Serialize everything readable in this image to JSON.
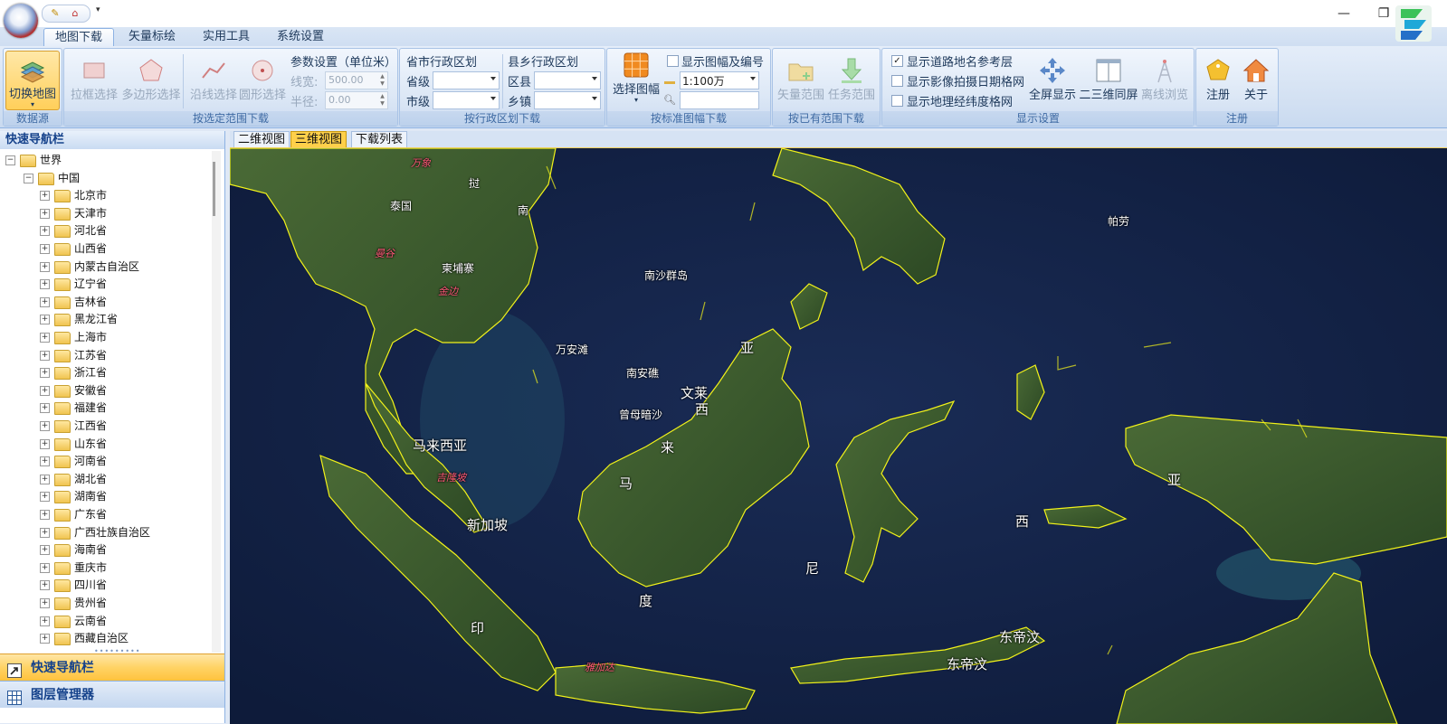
{
  "titlebar": {
    "minimize": "—",
    "maximize": "❐",
    "qat_dropdown": "▾"
  },
  "ribbon_tabs": [
    "地图下载",
    "矢量标绘",
    "实用工具",
    "系统设置"
  ],
  "groups": {
    "datasource": {
      "button": "切换地图",
      "caption": "数据源"
    },
    "range": {
      "buttons": [
        "拉框选择",
        "多边形选择",
        "沿线选择",
        "圆形选择"
      ],
      "params_title": "参数设置（单位米）",
      "line_width_label": "线宽:",
      "line_width_value": "500.00",
      "radius_label": "半径:",
      "radius_value": "0.00",
      "caption": "按选定范围下载"
    },
    "admin": {
      "province_city_title": "省市行政区划",
      "province_label": "省级",
      "city_label": "市级",
      "county_town_title": "县乡行政区划",
      "county_label": "区县",
      "town_label": "乡镇",
      "caption": "按行政区划下载"
    },
    "sheet": {
      "button": "选择图幅",
      "show_sheet_label": "显示图幅及编号",
      "scale_value": "1:100万",
      "caption": "按标准图幅下载"
    },
    "existing": {
      "buttons": [
        "矢量范围",
        "任务范围"
      ],
      "caption": "按已有范围下载"
    },
    "display": {
      "checks": [
        {
          "label": "显示道路地名参考层",
          "checked": true
        },
        {
          "label": "显示影像拍摄日期格网",
          "checked": false
        },
        {
          "label": "显示地理经纬度格网",
          "checked": false
        }
      ],
      "buttons": [
        "全屏显示",
        "二三维同屏",
        "离线浏览"
      ],
      "caption": "显示设置"
    },
    "register": {
      "buttons": [
        "注册",
        "关于"
      ],
      "caption": "注册"
    }
  },
  "left_panel": {
    "title": "快速导航栏",
    "tree_root": "世界",
    "tree_country": "中国",
    "tree_items": [
      "北京市",
      "天津市",
      "河北省",
      "山西省",
      "内蒙古自治区",
      "辽宁省",
      "吉林省",
      "黑龙江省",
      "上海市",
      "江苏省",
      "浙江省",
      "安徽省",
      "福建省",
      "江西省",
      "山东省",
      "河南省",
      "湖北省",
      "湖南省",
      "广东省",
      "广西壮族自治区",
      "海南省",
      "重庆市",
      "四川省",
      "贵州省",
      "云南省",
      "西藏自治区"
    ],
    "nav_buttons": [
      "快速导航栏",
      "图层管理器"
    ]
  },
  "view_tabs": [
    {
      "label": "二维视图",
      "active": false
    },
    {
      "label": "三维视图",
      "active": true
    },
    {
      "label": "下载列表",
      "active": false
    }
  ],
  "map_labels": {
    "wanxiang": "万象",
    "laos": "挝",
    "thailand": "泰国",
    "vietnam": "南",
    "bangkok": "曼谷",
    "cambodia": "柬埔寨",
    "phnompenh": "金边",
    "nansha": "南沙群岛",
    "wanan": "万安滩",
    "nanan": "南安礁",
    "zengmu": "曾母暗沙",
    "palau": "帕劳",
    "brunei": "文莱",
    "malaysia_country": "马来西亚",
    "kualalumpur": "吉隆坡",
    "singapore": "新加坡",
    "ma": "马",
    "lai": "来",
    "xi": "西",
    "ya": "亚",
    "yin": "印",
    "du": "度",
    "ni": "尼",
    "xi2": "西",
    "ya2": "亚",
    "easttimor1": "东帝汶",
    "easttimor2": "东帝汶",
    "jakarta": "雅加达"
  },
  "colors": {
    "border_yellow": "#f2f21a",
    "ocean": "#13234a",
    "land": "#3a5a2a"
  }
}
